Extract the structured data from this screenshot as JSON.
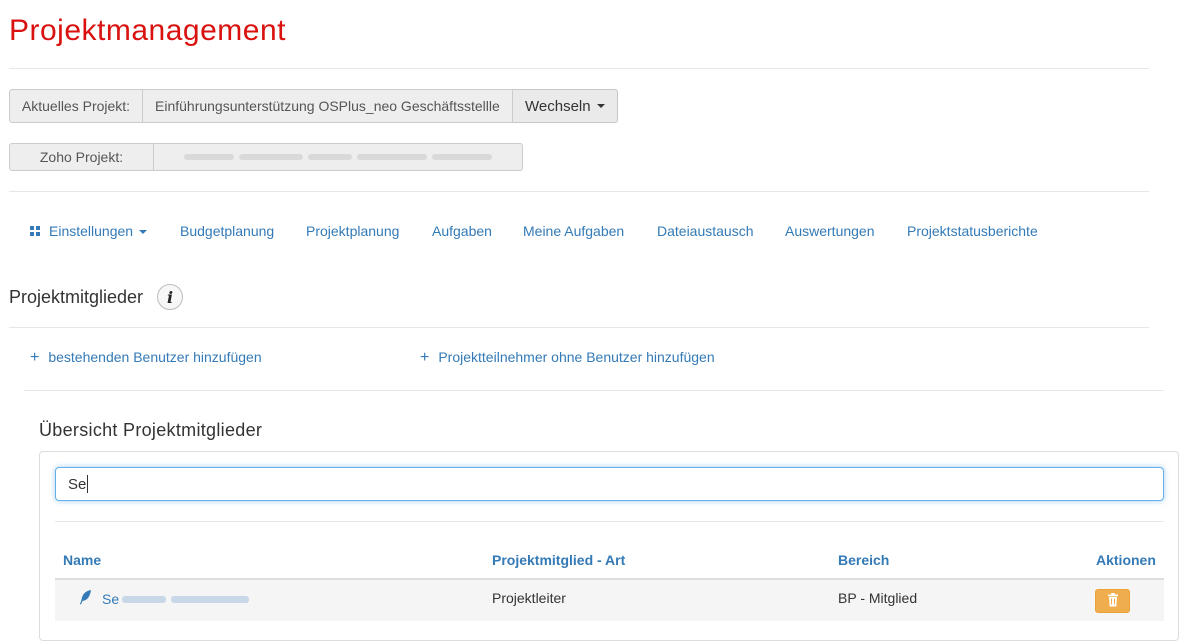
{
  "header": {
    "title": "Projektmanagement"
  },
  "current_project": {
    "label": "Aktuelles Projekt:",
    "value": "Einführungsunterstützung OSPlus_neo Geschäftsstellle",
    "switch_label": "Wechseln"
  },
  "zoho_project": {
    "label": "Zoho Projekt:"
  },
  "nav": {
    "settings": "Einstellungen",
    "items": [
      "Budgetplanung",
      "Projektplanung",
      "Aufgaben",
      "Meine Aufgaben",
      "Dateiaustausch",
      "Auswertungen",
      "Projektstatusberichte"
    ]
  },
  "members": {
    "title": "Projektmitglieder",
    "info_icon": "info-icon",
    "add_existing_user": "bestehenden Benutzer hinzufügen",
    "add_participant_without_user": "Projektteilnehmer ohne Benutzer hinzufügen",
    "overview_title": "Übersicht Projektmitglieder",
    "search_value": "Se",
    "table": {
      "headers": [
        "Name",
        "Projektmitglied - Art",
        "Bereich",
        "Aktionen"
      ],
      "rows": [
        {
          "name_visible": "Se",
          "type": "Projektleiter",
          "area": "BP - Mitglied"
        }
      ]
    }
  },
  "colors": {
    "title_red": "#d9120f",
    "link_blue": "#337ab7",
    "delete_orange": "#f0ad4e"
  }
}
